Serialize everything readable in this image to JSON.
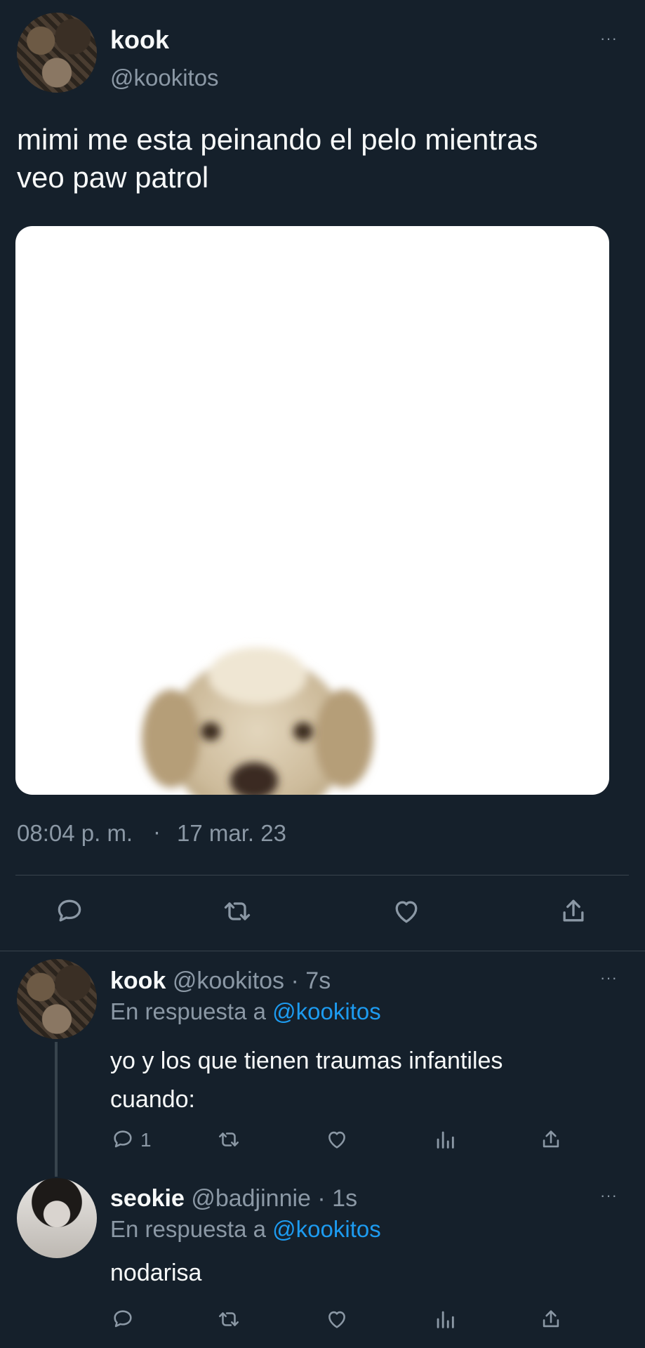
{
  "main_tweet": {
    "display_name": "kook",
    "handle": "@kookitos",
    "text_line1": "mimi me esta peinando el pelo mientras",
    "text_line2": "veo paw patrol",
    "time": "08:04 p. m.",
    "separator": "·",
    "date": "17 mar. 23",
    "more_label": "···"
  },
  "reply1": {
    "display_name": "kook",
    "handle": "@kookitos",
    "time": "· 7s",
    "reply_prefix": "En respuesta a",
    "reply_to": "@kookitos",
    "text_line1": "yo y los que tienen traumas infantiles",
    "text_line2": "cuando:",
    "reply_count": "1",
    "more_label": "···"
  },
  "reply2": {
    "display_name": "seokie",
    "handle": "@badjinnie",
    "time": "· 1s",
    "reply_prefix": "En respuesta a",
    "reply_to": "@kookitos",
    "text": "nodarisa",
    "more_label": "···"
  },
  "colors": {
    "background": "#15202b",
    "text": "#f7f9f9",
    "muted": "#8b98a5",
    "link": "#1d9bf0",
    "divider": "#38444d"
  }
}
